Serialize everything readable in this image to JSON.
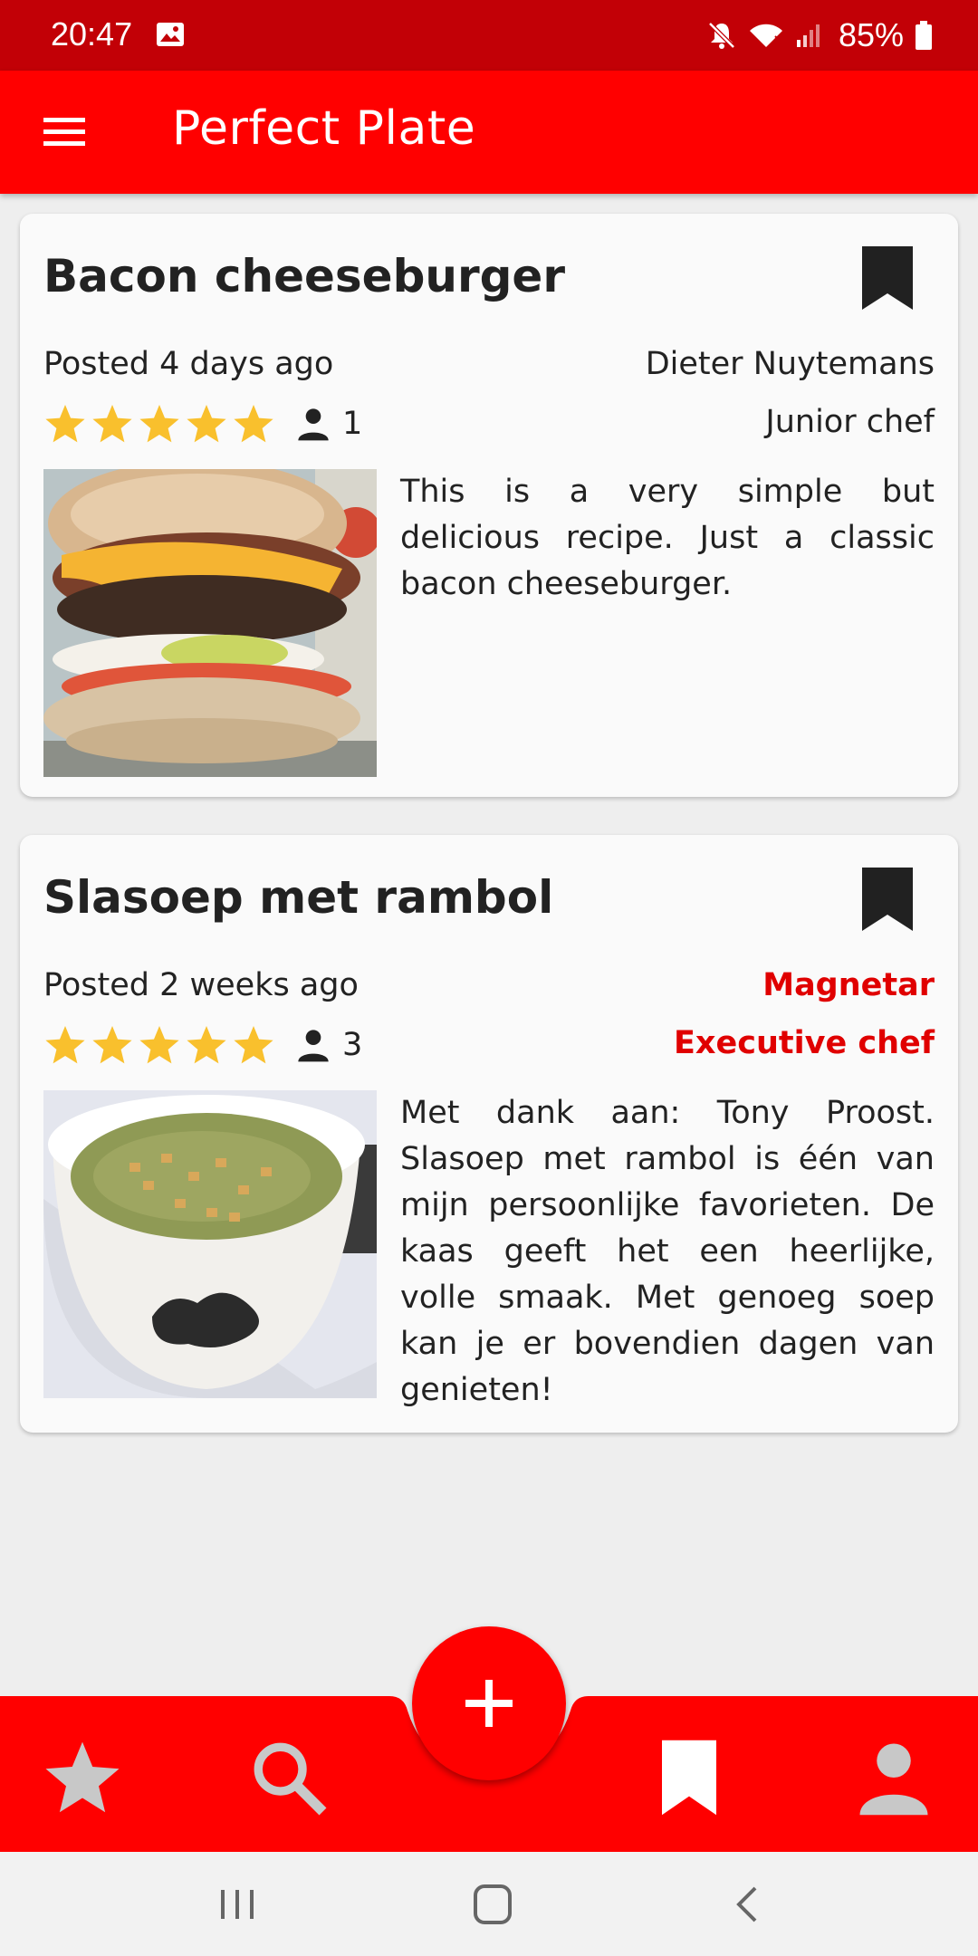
{
  "status_bar": {
    "time": "20:47",
    "battery": "85%"
  },
  "app_bar": {
    "title": "Perfect Plate"
  },
  "recipes": [
    {
      "title": "Bacon cheeseburger",
      "posted": "Posted 4 days ago",
      "author": "Dieter Nuytemans",
      "rank": "Junior chef",
      "author_highlight": false,
      "stars": 5,
      "raters": "1",
      "description": "This is a very simple but delicious recipe. Just a classic bacon cheeseburger.",
      "image": "burger-photo"
    },
    {
      "title": "Slasoep met rambol",
      "posted": "Posted 2 weeks ago",
      "author": "Magnetar",
      "rank": "Executive chef",
      "author_highlight": true,
      "stars": 5,
      "raters": "3",
      "description": "Met dank aan: Tony Proost. Slasoep met rambol is één van mijn persoonlijke favorieten. De kaas geeft het een heerlijke, volle smaak. Met genoeg soep kan je er bovendien dagen van genieten!",
      "image": "soup-photo"
    }
  ],
  "bottom_nav": {
    "items": [
      "star-icon",
      "search-icon",
      "bookmark-icon",
      "person-icon"
    ],
    "fab": "add-icon"
  },
  "colors": {
    "primary": "#ff0000",
    "status_bar": "#c20006",
    "highlight_text": "#e00000",
    "star": "#f9c02d"
  }
}
